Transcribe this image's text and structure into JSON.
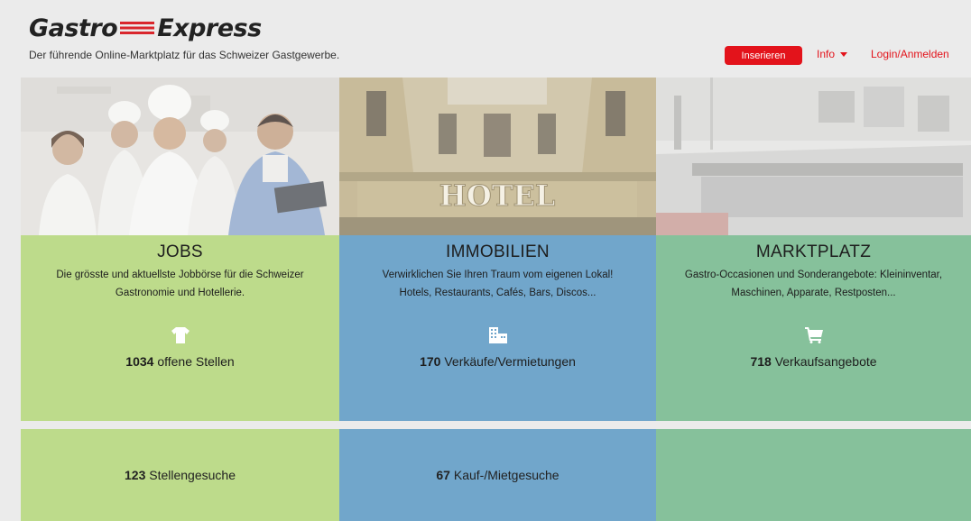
{
  "header": {
    "logo_left": "Gastro",
    "logo_right": "Express",
    "tagline": "Der führende Online-Marktplatz für das Schweizer Gastgewerbe.",
    "insert_button": "Inserieren",
    "info_label": "Info",
    "login_label": "Login/Anmelden"
  },
  "jobs": {
    "title": "JOBS",
    "description_line1": "Die grösste und aktuellste Jobbörse für die Schweizer",
    "description_line2": "Gastronomie und Hotellerie.",
    "icon": "chef-jacket-icon",
    "count": "1034",
    "count_label": "offene Stellen",
    "secondary_count": "123",
    "secondary_label": "Stellengesuche"
  },
  "immobilien": {
    "title": "IMMOBILIEN",
    "description_line1": "Verwirklichen Sie Ihren Traum vom eigenen Lokal!",
    "description_line2": "Hotels, Restaurants, Cafés, Bars, Discos...",
    "icon": "building-icon",
    "count": "170",
    "count_label": "Verkäufe/Vermietungen",
    "secondary_count": "67",
    "secondary_label": "Kauf-/Mietgesuche",
    "photo_sign": "HOTEL"
  },
  "marktplatz": {
    "title": "MARKTPLATZ",
    "description_line1": "Gastro-Occasionen und Sonderangebote: Kleininventar,",
    "description_line2": "Maschinen, Apparate, Restposten...",
    "icon": "shopping-cart-icon",
    "count": "718",
    "count_label": "Verkaufsangebote"
  },
  "colors": {
    "accent_red": "#e3131b",
    "jobs_green": "#bddb8b",
    "immobilien_blue": "#71a6cb",
    "marktplatz_teal": "#86c19b"
  }
}
